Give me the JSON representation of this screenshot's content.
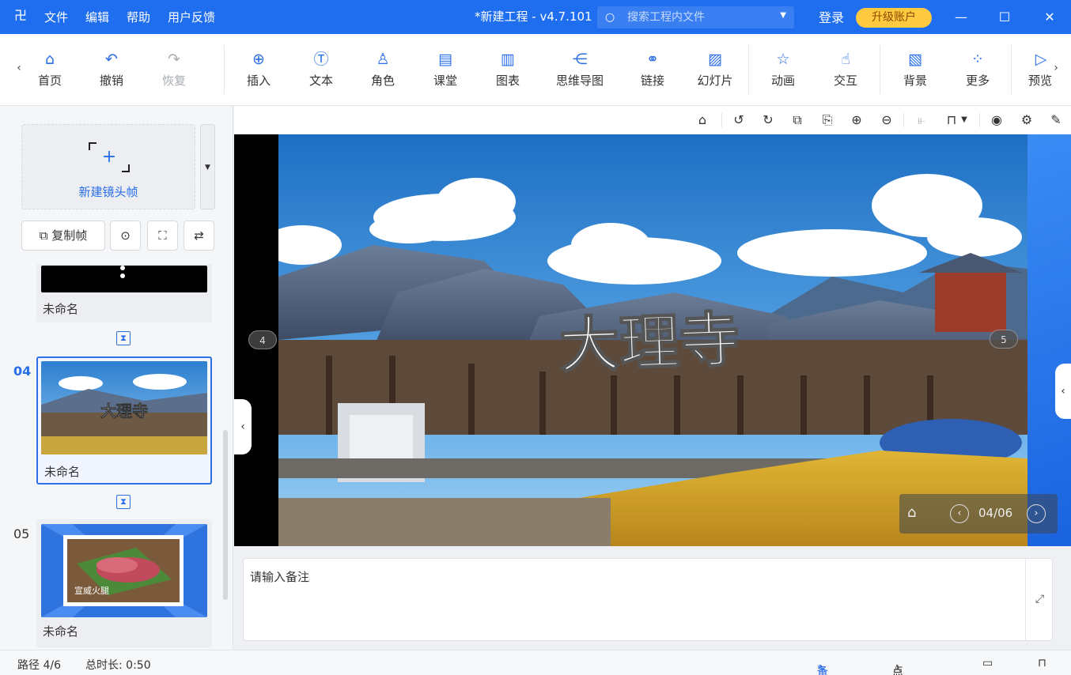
{
  "titlebar": {
    "logo": "卍",
    "menu": [
      "文件",
      "编辑",
      "帮助",
      "用户反馈"
    ],
    "title": "*新建工程 - v4.7.101",
    "search_placeholder": "搜索工程内文件",
    "login": "登录",
    "upgrade": "升级账户",
    "minimize": "—",
    "maximize": "☐",
    "close": "✕"
  },
  "toolbar": {
    "items": [
      {
        "label": "首页",
        "icon": "⌂"
      },
      {
        "label": "撤销",
        "icon": "↶"
      },
      {
        "label": "恢复",
        "icon": "↷"
      },
      {
        "label": "插入",
        "icon": "⊕"
      },
      {
        "label": "文本",
        "icon": "Ⓣ"
      },
      {
        "label": "角色",
        "icon": "♙"
      },
      {
        "label": "课堂",
        "icon": "▤"
      },
      {
        "label": "图表",
        "icon": "▥"
      },
      {
        "label": "思维导图",
        "icon": "⋲"
      },
      {
        "label": "链接",
        "icon": "⚭"
      },
      {
        "label": "幻灯片",
        "icon": "▨"
      },
      {
        "label": "动画",
        "icon": "☆"
      },
      {
        "label": "交互",
        "icon": "☝"
      },
      {
        "label": "背景",
        "icon": "▧"
      },
      {
        "label": "更多",
        "icon": "⁘"
      },
      {
        "label": "预览",
        "icon": "▷"
      }
    ]
  },
  "left_panel": {
    "new_frame_label": "新建镜头帧",
    "copy_frame_label": "复制帧",
    "slides": [
      {
        "number": "",
        "name": "未命名"
      },
      {
        "number": "04",
        "name": "未命名",
        "thumb_title": "大理寺"
      },
      {
        "number": "05",
        "name": "未命名",
        "thumb_title": "宣威火腿"
      }
    ]
  },
  "canvas": {
    "main_title": "大理寺",
    "prev_marker": "4",
    "next_marker": "5",
    "page_counter": "04/06"
  },
  "notes": {
    "placeholder": "请输入备注"
  },
  "status": {
    "path": "路径 4/6",
    "duration": "总时长: 0:50",
    "notes_btn": "备注",
    "rollcall_btn": "点名"
  }
}
